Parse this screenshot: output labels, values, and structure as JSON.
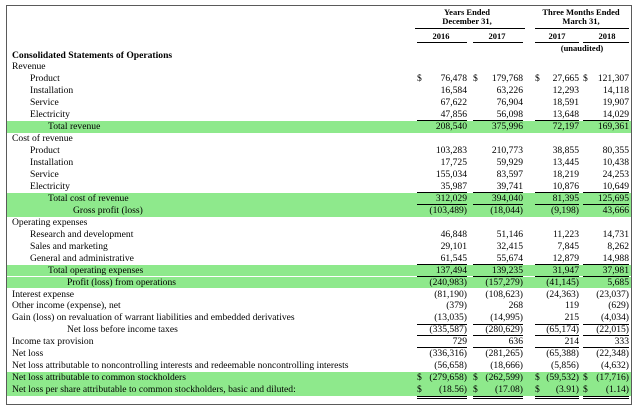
{
  "header": {
    "years_ended_line1": "Years Ended",
    "years_ended_line2": "December 31,",
    "three_months_line1": "Three Months Ended",
    "three_months_line2": "March 31,",
    "columns": [
      "2016",
      "2017",
      "2017",
      "2018"
    ],
    "unaudited": "(unaudited)"
  },
  "rows": [
    {
      "label": "Consolidated Statements of Operations",
      "indent": 0,
      "bold": true,
      "hl": false,
      "cells": null
    },
    {
      "label": "Revenue",
      "indent": 0,
      "hl": false,
      "cells": null
    },
    {
      "label": "Product",
      "indent": 1,
      "hl": false,
      "cells": [
        {
          "sym": "$",
          "num": "76,478"
        },
        {
          "sym": "$",
          "num": "179,768"
        },
        {
          "sym": "$",
          "num": "27,665"
        },
        {
          "sym": "$",
          "num": "121,307"
        }
      ]
    },
    {
      "label": "Installation",
      "indent": 1,
      "hl": false,
      "cells": [
        {
          "num": "16,584"
        },
        {
          "num": "63,226"
        },
        {
          "num": "12,293"
        },
        {
          "num": "14,118"
        }
      ]
    },
    {
      "label": "Service",
      "indent": 1,
      "hl": false,
      "cells": [
        {
          "num": "67,622"
        },
        {
          "num": "76,904"
        },
        {
          "num": "18,591"
        },
        {
          "num": "19,907"
        }
      ]
    },
    {
      "label": "Electricity",
      "indent": 1,
      "hl": false,
      "cells": [
        {
          "num": "47,856"
        },
        {
          "num": "56,098"
        },
        {
          "num": "13,648"
        },
        {
          "num": "14,029"
        }
      ]
    },
    {
      "label": "Total revenue",
      "indent": 3,
      "hl": true,
      "line": "top",
      "cells": [
        {
          "num": "208,540"
        },
        {
          "num": "375,996"
        },
        {
          "num": "72,197"
        },
        {
          "num": "169,361"
        }
      ]
    },
    {
      "label": "Cost of revenue",
      "indent": 0,
      "hl": false,
      "cells": null
    },
    {
      "label": "Product",
      "indent": 1,
      "hl": false,
      "cells": [
        {
          "num": "103,283"
        },
        {
          "num": "210,773"
        },
        {
          "num": "38,855"
        },
        {
          "num": "80,355"
        }
      ]
    },
    {
      "label": "Installation",
      "indent": 1,
      "hl": false,
      "cells": [
        {
          "num": "17,725"
        },
        {
          "num": "59,929"
        },
        {
          "num": "13,445"
        },
        {
          "num": "10,438"
        }
      ]
    },
    {
      "label": "Service",
      "indent": 1,
      "hl": false,
      "cells": [
        {
          "num": "155,034"
        },
        {
          "num": "83,597"
        },
        {
          "num": "18,219"
        },
        {
          "num": "24,253"
        }
      ]
    },
    {
      "label": "Electricity",
      "indent": 1,
      "hl": false,
      "cells": [
        {
          "num": "35,987"
        },
        {
          "num": "39,741"
        },
        {
          "num": "10,876"
        },
        {
          "num": "10,649"
        }
      ]
    },
    {
      "label": "Total cost of revenue",
      "indent": 3,
      "hl": true,
      "line": "top",
      "cells": [
        {
          "num": "312,029"
        },
        {
          "num": "394,040"
        },
        {
          "num": "81,395"
        },
        {
          "num": "125,695"
        }
      ]
    },
    {
      "label": "Gross profit (loss)",
      "indent": 5,
      "hl": true,
      "line": "top",
      "cells": [
        {
          "num": "(103,489)"
        },
        {
          "num": "(18,044)"
        },
        {
          "num": "(9,198)"
        },
        {
          "num": "43,666"
        }
      ]
    },
    {
      "label": "Operating expenses",
      "indent": 0,
      "hl": false,
      "cells": null
    },
    {
      "label": "Research and development",
      "indent": 1,
      "hl": false,
      "cells": [
        {
          "num": "46,848"
        },
        {
          "num": "51,146"
        },
        {
          "num": "11,223"
        },
        {
          "num": "14,731"
        }
      ]
    },
    {
      "label": "Sales and marketing",
      "indent": 1,
      "hl": false,
      "cells": [
        {
          "num": "29,101"
        },
        {
          "num": "32,415"
        },
        {
          "num": "7,845"
        },
        {
          "num": "8,262"
        }
      ]
    },
    {
      "label": "General and administrative",
      "indent": 1,
      "hl": false,
      "cells": [
        {
          "num": "61,545"
        },
        {
          "num": "55,674"
        },
        {
          "num": "12,879"
        },
        {
          "num": "14,988"
        }
      ]
    },
    {
      "label": "Total operating expenses",
      "indent": 3,
      "hl": true,
      "line": "top",
      "cells": [
        {
          "num": "137,494"
        },
        {
          "num": "139,235"
        },
        {
          "num": "31,947"
        },
        {
          "num": "37,981"
        }
      ]
    },
    {
      "label": "Profit (loss) from operations",
      "indent": 4,
      "hl": true,
      "line": "top",
      "cells": [
        {
          "num": "(240,983)"
        },
        {
          "num": "(157,279)"
        },
        {
          "num": "(41,145)"
        },
        {
          "num": "5,685"
        }
      ]
    },
    {
      "label": "Interest expense",
      "indent": 0,
      "hl": false,
      "cells": [
        {
          "num": "(81,190)"
        },
        {
          "num": "(108,623)"
        },
        {
          "num": "(24,363)"
        },
        {
          "num": "(23,037)"
        }
      ]
    },
    {
      "label": "Other income (expense), net",
      "indent": 0,
      "hl": false,
      "cells": [
        {
          "num": "(379)"
        },
        {
          "num": "268"
        },
        {
          "num": "119"
        },
        {
          "num": "(629)"
        }
      ]
    },
    {
      "label": "Gain (loss) on revaluation of warrant liabilities and embedded derivatives",
      "indent": 0,
      "hl": false,
      "line": "bottom",
      "cells": [
        {
          "num": "(13,035)"
        },
        {
          "num": "(14,995)"
        },
        {
          "num": "215"
        },
        {
          "num": "(4,034)"
        }
      ]
    },
    {
      "label": "Net loss before income taxes",
      "indent": 6,
      "hl": false,
      "cells": [
        {
          "num": "(335,587)"
        },
        {
          "num": "(280,629)"
        },
        {
          "num": "(65,174)"
        },
        {
          "num": "(22,015)"
        }
      ]
    },
    {
      "label": "Income tax provision",
      "indent": 0,
      "hl": false,
      "line": "top",
      "cells": [
        {
          "num": "729"
        },
        {
          "num": "636"
        },
        {
          "num": "214"
        },
        {
          "num": "333"
        }
      ]
    },
    {
      "label": "Net loss",
      "indent": 0,
      "hl": false,
      "line": "top",
      "cells": [
        {
          "num": "(336,316)"
        },
        {
          "num": "(281,265)"
        },
        {
          "num": "(65,388)"
        },
        {
          "num": "(22,348)"
        }
      ]
    },
    {
      "label": "Net loss attributable to noncontrolling interests and redeemable noncontrolling interests",
      "indent": 0,
      "hl": false,
      "line": "bottom",
      "cells": [
        {
          "num": "(56,658)"
        },
        {
          "num": "(18,666)"
        },
        {
          "num": "(5,856)"
        },
        {
          "num": "(4,632)"
        }
      ]
    },
    {
      "label": "Net loss attributable to common stockholders",
      "indent": 0,
      "hl": true,
      "line": "double",
      "cells": [
        {
          "sym": "$",
          "num": "(279,658)"
        },
        {
          "sym": "$",
          "num": "(262,599)"
        },
        {
          "sym": "$",
          "num": "(59,532)"
        },
        {
          "sym": "$",
          "num": "(17,716)"
        }
      ]
    },
    {
      "label": "Net loss per share attributable to common stockholders, basic and diluted:",
      "indent": 0,
      "hl": true,
      "line": "double",
      "cells": [
        {
          "sym": "$",
          "num": "(18.56)"
        },
        {
          "sym": "$",
          "num": "(17.08)"
        },
        {
          "sym": "$",
          "num": "(3.91)"
        },
        {
          "sym": "$",
          "num": "(1.14)"
        }
      ]
    }
  ]
}
